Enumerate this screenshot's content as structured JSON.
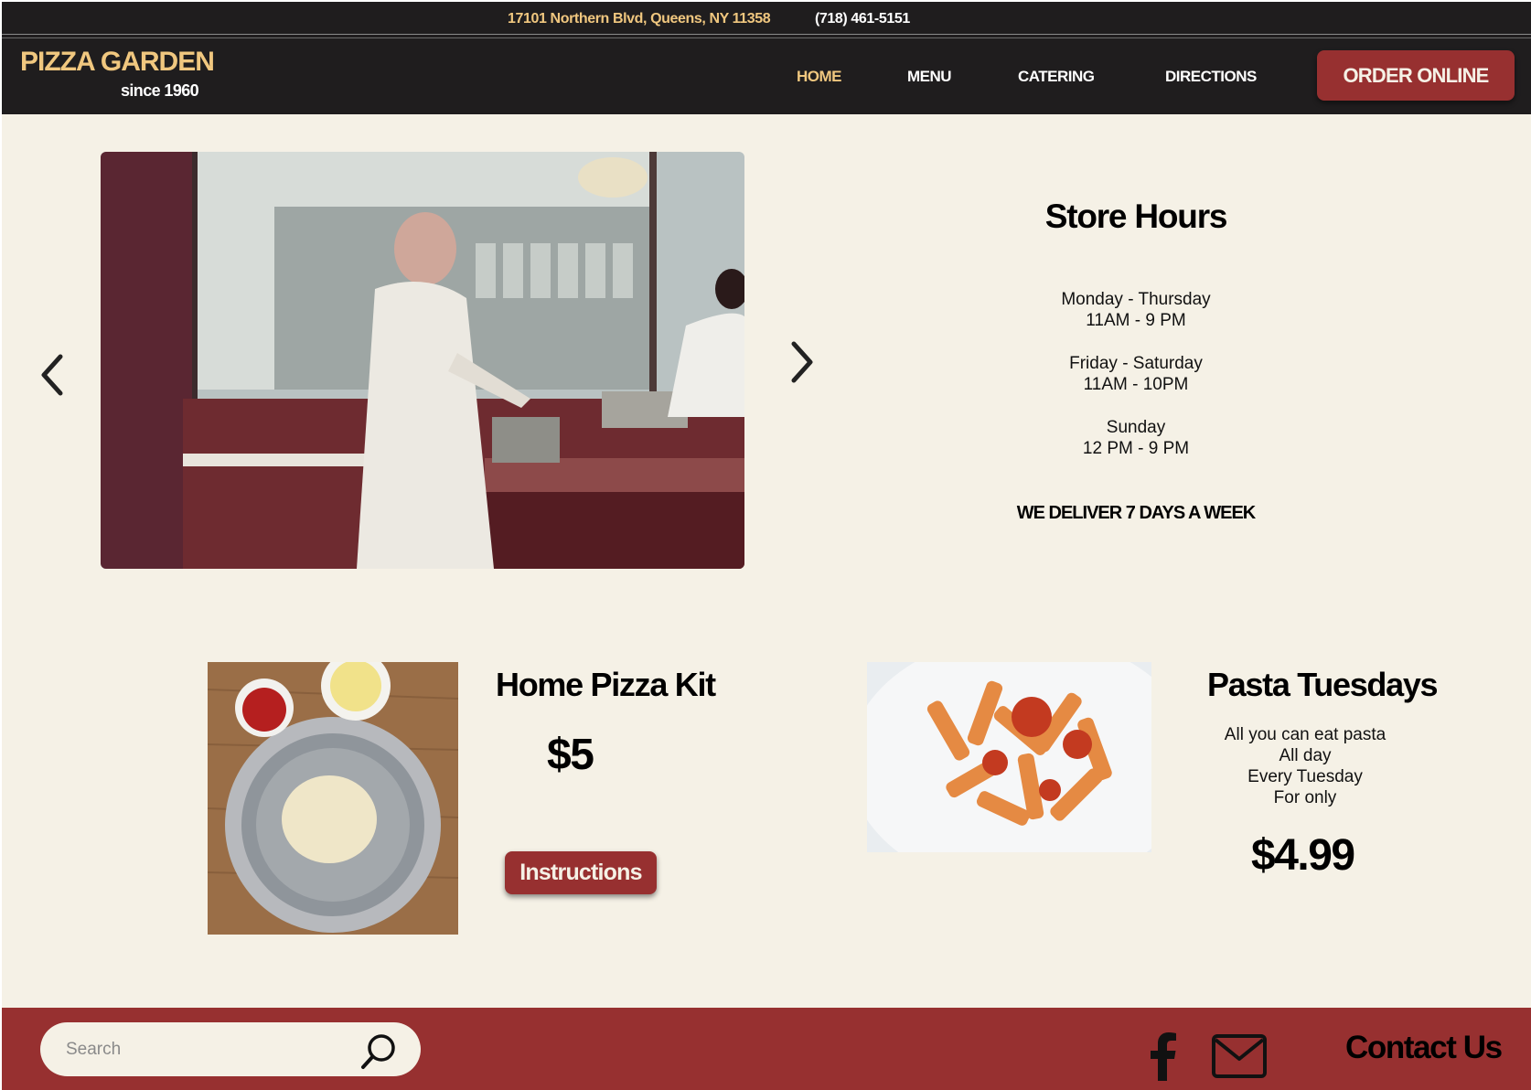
{
  "topbar": {
    "address": "17101 Northern Blvd, Queens, NY 11358",
    "phone": "(718) 461-5151"
  },
  "header": {
    "logo": "PIZZA GARDEN",
    "tagline": "since 1960",
    "nav": [
      {
        "label": "HOME",
        "active": true
      },
      {
        "label": "MENU",
        "active": false
      },
      {
        "label": "CATERING",
        "active": false
      },
      {
        "label": "DIRECTIONS",
        "active": false
      }
    ],
    "order_label": "ORDER ONLINE"
  },
  "slideshow": {
    "prev_icon": "chevron-left-icon",
    "next_icon": "chevron-right-icon"
  },
  "hours": {
    "title": "Store Hours",
    "blocks": [
      {
        "days": "Monday - Thursday",
        "time": "11AM - 9 PM"
      },
      {
        "days": "Friday - Saturday",
        "time": "11AM - 10PM"
      },
      {
        "days": "Sunday",
        "time": "12 PM - 9 PM"
      }
    ],
    "delivery": "WE DELIVER 7 DAYS A WEEK"
  },
  "kit": {
    "title": "Home Pizza Kit",
    "price": "$5",
    "button": "Instructions"
  },
  "pasta": {
    "title": "Pasta Tuesdays",
    "lines": [
      "All you can eat pasta",
      "All day",
      "Every Tuesday",
      "For only"
    ],
    "price": "$4.99"
  },
  "footer": {
    "search_placeholder": "Search",
    "contact": "Contact Us"
  },
  "colors": {
    "background": "#f5f1e6",
    "dark": "#1f1d1e",
    "accent": "#973030",
    "gold": "#f0c77f"
  }
}
